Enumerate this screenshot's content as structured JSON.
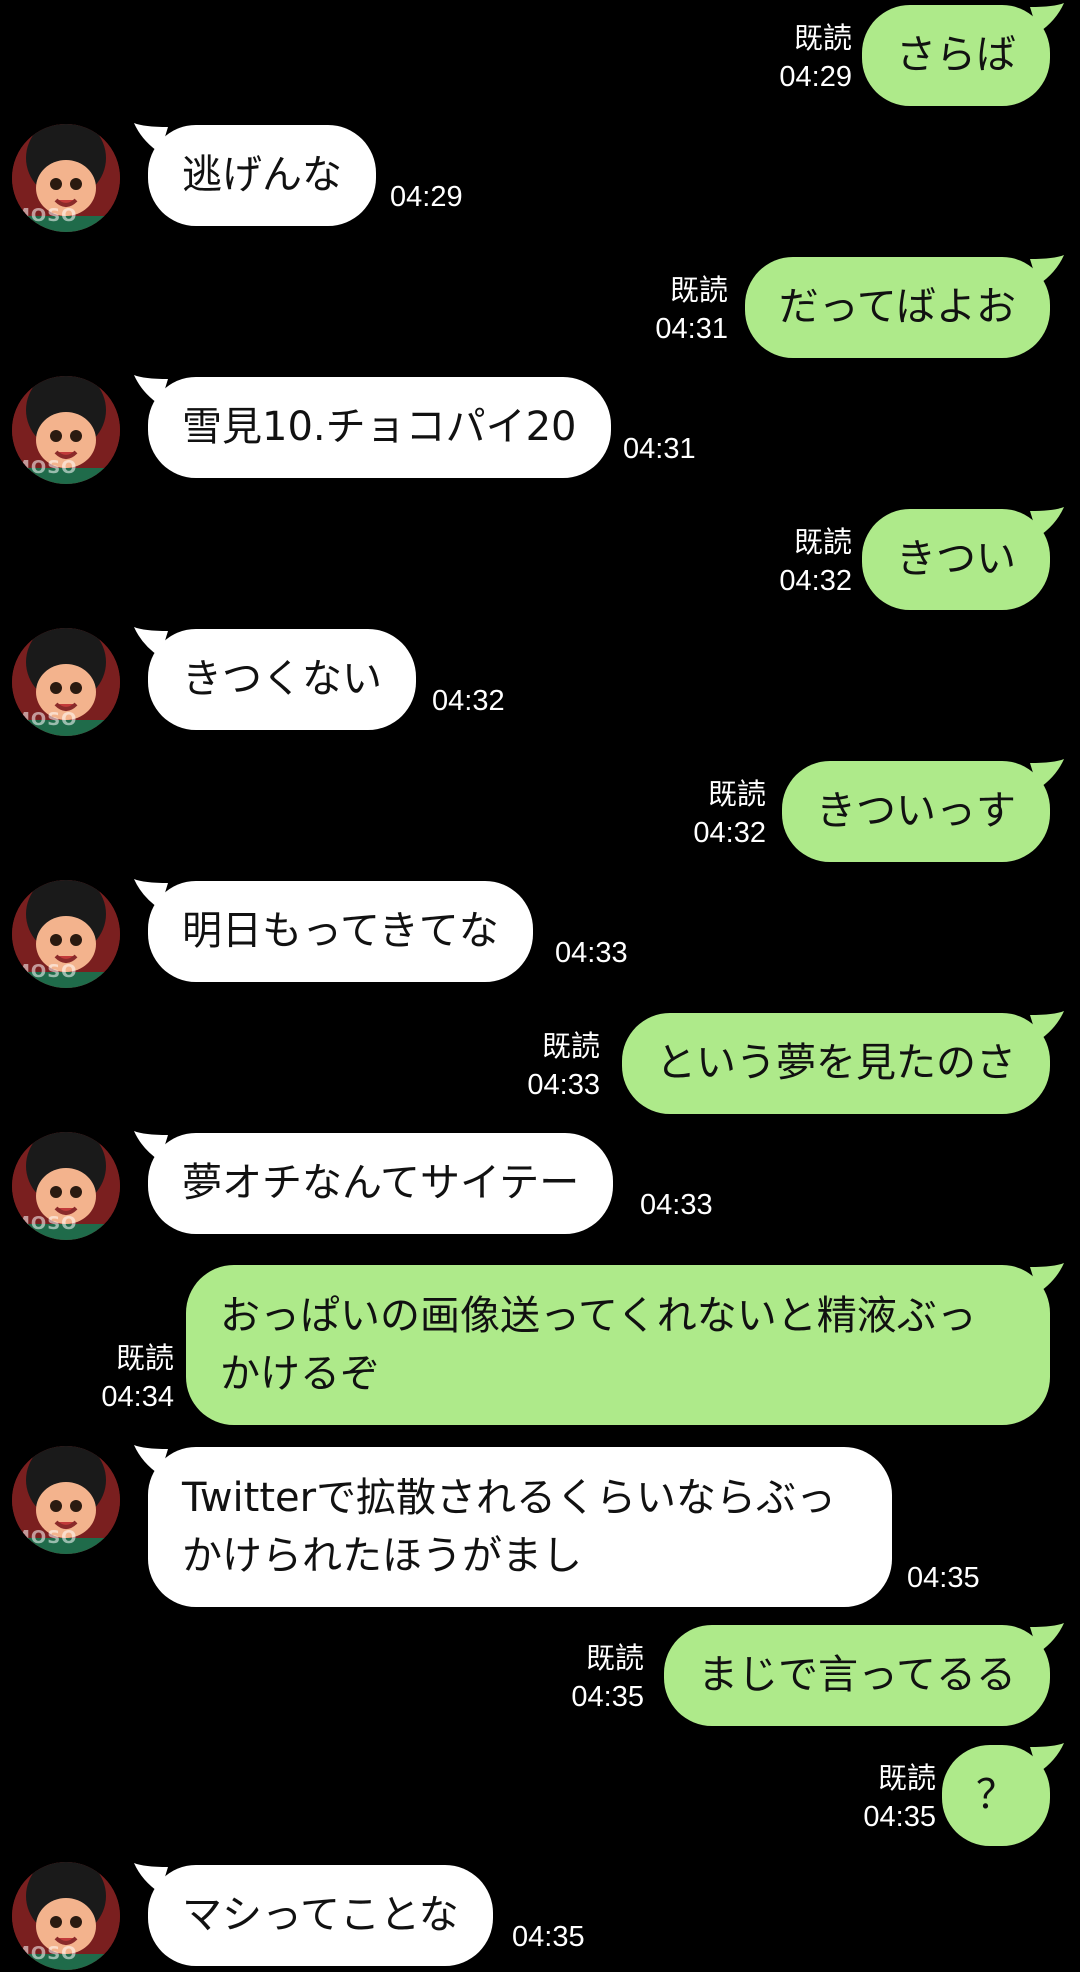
{
  "colors": {
    "background": "#000000",
    "sent_bubble": "#aeea8a",
    "recv_bubble": "#ffffff"
  },
  "avatar": {
    "watermark": "MOSO"
  },
  "messages": [
    {
      "side": "sent",
      "text": "さらば",
      "read": "既読",
      "time": "04:29"
    },
    {
      "side": "recv",
      "text": "逃げんな",
      "time": "04:29"
    },
    {
      "side": "sent",
      "text": "だってばよお",
      "read": "既読",
      "time": "04:31"
    },
    {
      "side": "recv",
      "text": "雪見10.チョコパイ20",
      "time": "04:31"
    },
    {
      "side": "sent",
      "text": "きつい",
      "read": "既読",
      "time": "04:32"
    },
    {
      "side": "recv",
      "text": "きつくない",
      "time": "04:32"
    },
    {
      "side": "sent",
      "text": "きついっす",
      "read": "既読",
      "time": "04:32"
    },
    {
      "side": "recv",
      "text": "明日もってきてな",
      "time": "04:33"
    },
    {
      "side": "sent",
      "text": "という夢を見たのさ",
      "read": "既読",
      "time": "04:33"
    },
    {
      "side": "recv",
      "text": "夢オチなんてサイテー",
      "time": "04:33"
    },
    {
      "side": "sent",
      "text": "おっぱいの画像送ってくれないと精液ぶっ",
      "text2": "かけるぞ",
      "read": "既読",
      "time": "04:34"
    },
    {
      "side": "recv",
      "text": "Twitterで拡散されるくらいならぶっ",
      "text2": "かけられたほうがまし",
      "time": "04:35"
    },
    {
      "side": "sent",
      "text": "まじで言ってるる",
      "read": "既読",
      "time": "04:35"
    },
    {
      "side": "sent",
      "text": "？",
      "read": "既読",
      "time": "04:35"
    },
    {
      "side": "recv",
      "text": "マシってことな",
      "time": "04:35"
    }
  ]
}
